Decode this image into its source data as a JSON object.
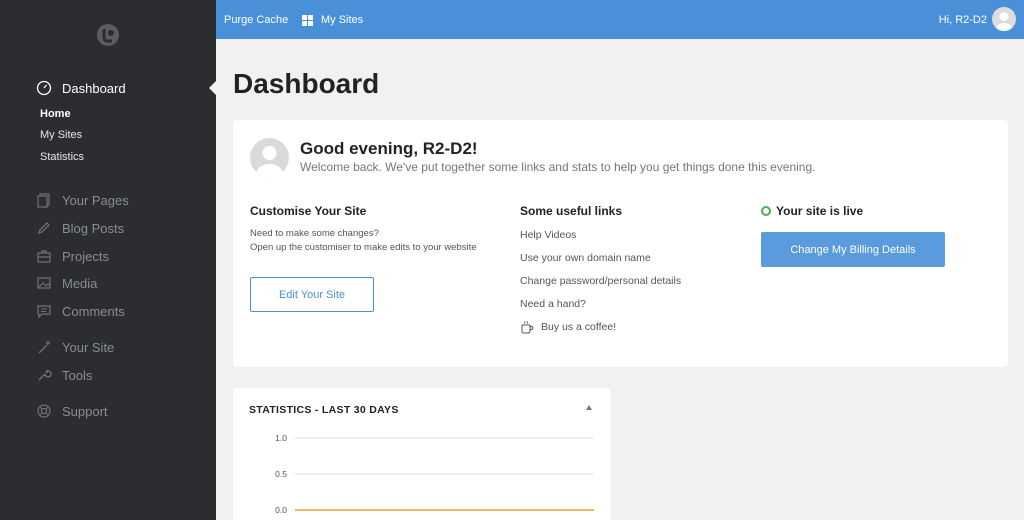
{
  "sidebar": {
    "nav": [
      {
        "label": "Dashboard",
        "icon": "gauge-icon"
      },
      {
        "label": "Your Pages",
        "icon": "pages-icon"
      },
      {
        "label": "Blog Posts",
        "icon": "pencil-icon"
      },
      {
        "label": "Projects",
        "icon": "briefcase-icon"
      },
      {
        "label": "Media",
        "icon": "image-icon"
      },
      {
        "label": "Comments",
        "icon": "comment-icon"
      },
      {
        "label": "Your Site",
        "icon": "wand-icon"
      },
      {
        "label": "Tools",
        "icon": "wrench-icon"
      },
      {
        "label": "Support",
        "icon": "lifebuoy-icon"
      }
    ],
    "sub_items": [
      "Home",
      "My Sites",
      "Statistics"
    ]
  },
  "topbar": {
    "purge_cache": "Purge Cache",
    "my_sites": "My Sites",
    "greeting": "Hi, R2-D2"
  },
  "page": {
    "title": "Dashboard"
  },
  "welcome": {
    "title": "Good evening, R2-D2!",
    "subtitle": "Welcome back. We've put together some links and stats to help you get things done this evening."
  },
  "customise": {
    "title": "Customise Your Site",
    "line1": "Need to make some changes?",
    "line2": "Open up the customiser to make edits to your website",
    "button": "Edit Your Site"
  },
  "links": {
    "title": "Some useful links",
    "items": [
      "Help Videos",
      "Use your own domain name",
      "Change password/personal details",
      "Need a hand?"
    ],
    "coffee": "Buy us a coffee!"
  },
  "status": {
    "live": "Your site is live",
    "billing_button": "Change My Billing Details",
    "live_color": "#4cb050"
  },
  "stats": {
    "title": "STATISTICS - LAST 30 DAYS"
  },
  "chart_data": {
    "type": "line",
    "title": "",
    "y_ticks": [
      "1.0",
      "0.5",
      "0.0"
    ],
    "ylim": [
      0,
      1
    ],
    "series": [
      {
        "values": [
          0,
          0,
          0,
          0,
          0,
          0,
          0,
          0,
          0,
          0,
          0,
          0,
          0,
          0,
          0,
          0,
          0,
          0,
          0,
          0,
          0,
          0,
          0,
          0,
          0,
          0,
          0,
          0,
          0,
          0
        ],
        "color": "#f0a030"
      }
    ]
  },
  "colors": {
    "accent": "#4a90d9",
    "sidebar_bg": "#2b2d30"
  }
}
